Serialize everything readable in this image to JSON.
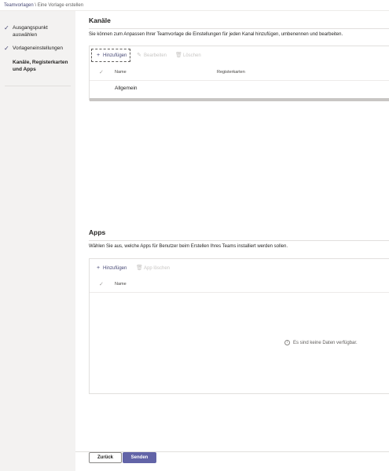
{
  "breadcrumb": {
    "parent": "Teamvorlagen",
    "separator": "\\",
    "current": "Eine Vorlage erstellen"
  },
  "steps": [
    {
      "label": "Ausgangspunkt auswählen",
      "completed": true,
      "active": false
    },
    {
      "label": "Vorlageneinstellungen",
      "completed": true,
      "active": false
    },
    {
      "label": "Kanäle, Registerkarten und Apps",
      "completed": false,
      "active": true
    }
  ],
  "channels": {
    "title": "Kanäle",
    "description": "Sie können zum Anpassen Ihrer Teamvorlage die Einstellungen für jeden Kanal hinzufügen, umbenennen und bearbeiten.",
    "commands": {
      "add": "Hinzufügen",
      "edit": "Bearbeiten",
      "delete": "Löschen"
    },
    "columns": {
      "name": "Name",
      "tabs": "Registerkarten"
    },
    "rows": [
      {
        "name": "Allgemein",
        "tabs": ""
      }
    ]
  },
  "apps": {
    "title": "Apps",
    "description": "Wählen Sie aus, welche Apps für Benutzer beim Erstellen Ihres Teams installiert werden sollen.",
    "commands": {
      "add": "Hinzufügen",
      "delete": "App löschen"
    },
    "columns": {
      "name": "Name"
    },
    "empty_message": "Es sind keine Daten verfügbar."
  },
  "footer": {
    "back_label": "Zurück",
    "submit_label": "Senden"
  },
  "colors": {
    "accent": "#6264a7",
    "accent_text": "#464775",
    "disabled": "#c8c6c4"
  },
  "icons": {
    "check": "checkmark-icon",
    "add": "plus-icon",
    "edit": "pencil-icon",
    "delete": "trash-icon",
    "info": "info-icon"
  }
}
